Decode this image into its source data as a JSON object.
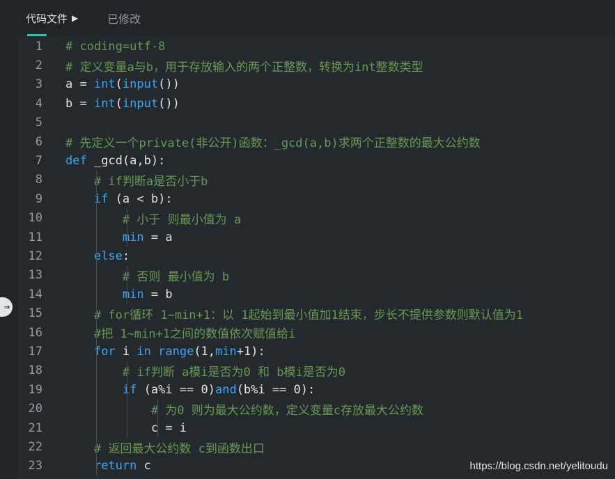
{
  "tabs": {
    "file_label": "代码文件",
    "modified_label": "已修改"
  },
  "watermark": "https://blog.csdn.net/yelitoudu",
  "lines": [
    {
      "n": "1",
      "parts": [
        {
          "t": "# coding=utf-8",
          "c": "cmt"
        }
      ]
    },
    {
      "n": "2",
      "parts": [
        {
          "t": "# 定义变量a与b，用于存放输入的两个正整数，转换为int整数类型",
          "c": "cmt"
        }
      ]
    },
    {
      "n": "3",
      "parts": [
        {
          "t": "a = ",
          "c": "txt"
        },
        {
          "t": "int",
          "c": "fn"
        },
        {
          "t": "(",
          "c": "txt"
        },
        {
          "t": "input",
          "c": "fn"
        },
        {
          "t": "())",
          "c": "txt"
        }
      ]
    },
    {
      "n": "4",
      "parts": [
        {
          "t": "b = ",
          "c": "txt"
        },
        {
          "t": "int",
          "c": "fn"
        },
        {
          "t": "(",
          "c": "txt"
        },
        {
          "t": "input",
          "c": "fn"
        },
        {
          "t": "())",
          "c": "txt"
        }
      ]
    },
    {
      "n": "5",
      "parts": []
    },
    {
      "n": "6",
      "parts": [
        {
          "t": "# 先定义一个private(非公开)函数：_gcd(a,b)求两个正整数的最大公约数",
          "c": "cmt"
        }
      ]
    },
    {
      "n": "7",
      "parts": [
        {
          "t": "def",
          "c": "kw"
        },
        {
          "t": " _gcd(a,b):",
          "c": "txt"
        }
      ]
    },
    {
      "n": "8",
      "parts": [
        {
          "t": "    ",
          "c": "txt"
        },
        {
          "t": "# if判断a是否小于b",
          "c": "cmt"
        }
      ]
    },
    {
      "n": "9",
      "parts": [
        {
          "t": "    ",
          "c": "txt"
        },
        {
          "t": "if",
          "c": "kw"
        },
        {
          "t": " (a < b):",
          "c": "txt"
        }
      ]
    },
    {
      "n": "10",
      "parts": [
        {
          "t": "        ",
          "c": "txt"
        },
        {
          "t": "# 小于 则最小值为 a",
          "c": "cmt"
        }
      ]
    },
    {
      "n": "11",
      "parts": [
        {
          "t": "        ",
          "c": "txt"
        },
        {
          "t": "min",
          "c": "fn"
        },
        {
          "t": " = a",
          "c": "txt"
        }
      ]
    },
    {
      "n": "12",
      "parts": [
        {
          "t": "    ",
          "c": "txt"
        },
        {
          "t": "else",
          "c": "kw"
        },
        {
          "t": ":",
          "c": "txt"
        }
      ]
    },
    {
      "n": "13",
      "parts": [
        {
          "t": "        ",
          "c": "txt"
        },
        {
          "t": "# 否则 最小值为 b",
          "c": "cmt"
        }
      ]
    },
    {
      "n": "14",
      "parts": [
        {
          "t": "        ",
          "c": "txt"
        },
        {
          "t": "min",
          "c": "fn"
        },
        {
          "t": " = b",
          "c": "txt"
        }
      ]
    },
    {
      "n": "15",
      "parts": [
        {
          "t": "    ",
          "c": "txt"
        },
        {
          "t": "# for循环 1~min+1：以 1起始到最小值加1结束，步长不提供参数则默认值为1",
          "c": "cmt"
        }
      ]
    },
    {
      "n": "16",
      "parts": [
        {
          "t": "    ",
          "c": "txt"
        },
        {
          "t": "#把 1~min+1之间的数值依次赋值给i",
          "c": "cmt"
        }
      ]
    },
    {
      "n": "17",
      "parts": [
        {
          "t": "    ",
          "c": "txt"
        },
        {
          "t": "for",
          "c": "kw"
        },
        {
          "t": " i ",
          "c": "txt"
        },
        {
          "t": "in",
          "c": "kw"
        },
        {
          "t": " ",
          "c": "txt"
        },
        {
          "t": "range",
          "c": "fn"
        },
        {
          "t": "(1,",
          "c": "txt"
        },
        {
          "t": "min",
          "c": "fn"
        },
        {
          "t": "+1):",
          "c": "txt"
        }
      ]
    },
    {
      "n": "18",
      "parts": [
        {
          "t": "        ",
          "c": "txt"
        },
        {
          "t": "# if判断 a模i是否为0 和 b模i是否为0",
          "c": "cmt"
        }
      ]
    },
    {
      "n": "19",
      "parts": [
        {
          "t": "        ",
          "c": "txt"
        },
        {
          "t": "if",
          "c": "kw"
        },
        {
          "t": " (a%i == 0)",
          "c": "txt"
        },
        {
          "t": "and",
          "c": "kw"
        },
        {
          "t": "(b%i == 0):",
          "c": "txt"
        }
      ]
    },
    {
      "n": "20",
      "parts": [
        {
          "t": "            ",
          "c": "txt"
        },
        {
          "t": "# 为0 则为最大公约数，定义变量c存放最大公约数",
          "c": "cmt"
        }
      ]
    },
    {
      "n": "21",
      "parts": [
        {
          "t": "            ",
          "c": "txt"
        },
        {
          "t": "c = i",
          "c": "txt"
        }
      ]
    },
    {
      "n": "22",
      "parts": [
        {
          "t": "    ",
          "c": "txt"
        },
        {
          "t": "# 返回最大公约数 c到函数出口",
          "c": "cmt"
        }
      ]
    },
    {
      "n": "23",
      "parts": [
        {
          "t": "    ",
          "c": "txt"
        },
        {
          "t": "return",
          "c": "kw"
        },
        {
          "t": " c",
          "c": "txt"
        }
      ]
    }
  ]
}
